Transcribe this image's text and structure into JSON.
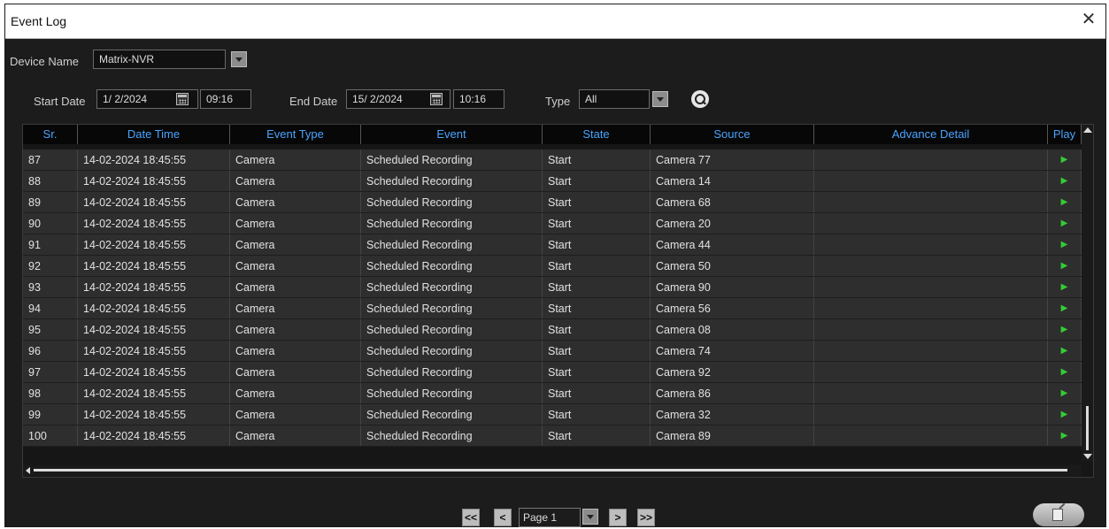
{
  "window": {
    "title": "Event Log",
    "close_glyph": "✕"
  },
  "filters": {
    "device_label": "Device Name",
    "device_value": "Matrix-NVR",
    "start_label": "Start Date",
    "start_date": "1/ 2/2024",
    "start_time": "09:16",
    "end_label": "End Date",
    "end_date": "15/ 2/2024",
    "end_time": "10:16",
    "type_label": "Type",
    "type_value": "All"
  },
  "table": {
    "columns": [
      "Sr.",
      "Date Time",
      "Event Type",
      "Event",
      "State",
      "Source",
      "Advance Detail",
      "Play"
    ],
    "rows": [
      {
        "sr": "87",
        "datetime": "14-02-2024 18:45:55",
        "event_type": "Camera",
        "event": "Scheduled Recording",
        "state": "Start",
        "source": "Camera 77",
        "detail": "",
        "play": "▶"
      },
      {
        "sr": "88",
        "datetime": "14-02-2024 18:45:55",
        "event_type": "Camera",
        "event": "Scheduled Recording",
        "state": "Start",
        "source": "Camera 14",
        "detail": "",
        "play": "▶"
      },
      {
        "sr": "89",
        "datetime": "14-02-2024 18:45:55",
        "event_type": "Camera",
        "event": "Scheduled Recording",
        "state": "Start",
        "source": "Camera 68",
        "detail": "",
        "play": "▶"
      },
      {
        "sr": "90",
        "datetime": "14-02-2024 18:45:55",
        "event_type": "Camera",
        "event": "Scheduled Recording",
        "state": "Start",
        "source": "Camera 20",
        "detail": "",
        "play": "▶"
      },
      {
        "sr": "91",
        "datetime": "14-02-2024 18:45:55",
        "event_type": "Camera",
        "event": "Scheduled Recording",
        "state": "Start",
        "source": "Camera 44",
        "detail": "",
        "play": "▶"
      },
      {
        "sr": "92",
        "datetime": "14-02-2024 18:45:55",
        "event_type": "Camera",
        "event": "Scheduled Recording",
        "state": "Start",
        "source": "Camera 50",
        "detail": "",
        "play": "▶"
      },
      {
        "sr": "93",
        "datetime": "14-02-2024 18:45:55",
        "event_type": "Camera",
        "event": "Scheduled Recording",
        "state": "Start",
        "source": "Camera 90",
        "detail": "",
        "play": "▶"
      },
      {
        "sr": "94",
        "datetime": "14-02-2024 18:45:55",
        "event_type": "Camera",
        "event": "Scheduled Recording",
        "state": "Start",
        "source": "Camera 56",
        "detail": "",
        "play": "▶"
      },
      {
        "sr": "95",
        "datetime": "14-02-2024 18:45:55",
        "event_type": "Camera",
        "event": "Scheduled Recording",
        "state": "Start",
        "source": "Camera 08",
        "detail": "",
        "play": "▶"
      },
      {
        "sr": "96",
        "datetime": "14-02-2024 18:45:55",
        "event_type": "Camera",
        "event": "Scheduled Recording",
        "state": "Start",
        "source": "Camera 74",
        "detail": "",
        "play": "▶"
      },
      {
        "sr": "97",
        "datetime": "14-02-2024 18:45:55",
        "event_type": "Camera",
        "event": "Scheduled Recording",
        "state": "Start",
        "source": "Camera 92",
        "detail": "",
        "play": "▶"
      },
      {
        "sr": "98",
        "datetime": "14-02-2024 18:45:55",
        "event_type": "Camera",
        "event": "Scheduled Recording",
        "state": "Start",
        "source": "Camera 86",
        "detail": "",
        "play": "▶"
      },
      {
        "sr": "99",
        "datetime": "14-02-2024 18:45:55",
        "event_type": "Camera",
        "event": "Scheduled Recording",
        "state": "Start",
        "source": "Camera 32",
        "detail": "",
        "play": "▶"
      },
      {
        "sr": "100",
        "datetime": "14-02-2024 18:45:55",
        "event_type": "Camera",
        "event": "Scheduled Recording",
        "state": "Start",
        "source": "Camera 89",
        "detail": "",
        "play": "▶"
      }
    ]
  },
  "pager": {
    "first_glyph": "<<",
    "prev_glyph": "<",
    "page_value": "Page 1",
    "next_glyph": ">",
    "last_glyph": ">>"
  },
  "icons": {
    "calendar": "calendar-icon",
    "search": "search-icon",
    "play": "play-icon",
    "export": "export-icon"
  },
  "colors": {
    "header_text": "#4aa3ff",
    "play_arrow": "#33cc33",
    "background": "#1c1c1c"
  }
}
